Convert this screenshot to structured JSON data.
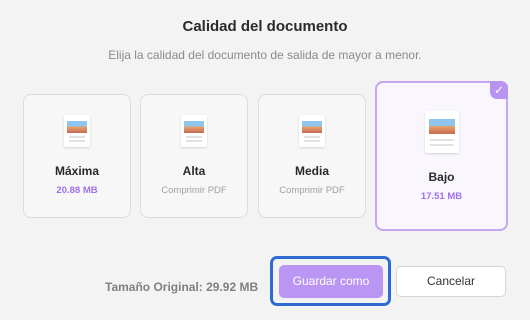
{
  "dialog": {
    "title": "Calidad del documento",
    "subtitle": "Elija la calidad del documento de salida de mayor a menor."
  },
  "options": [
    {
      "label": "Máxima",
      "detail": "20.88 MB",
      "selected": false
    },
    {
      "label": "Alta",
      "detail": "Comprimir PDF",
      "selected": false
    },
    {
      "label": "Media",
      "detail": "Comprimir PDF",
      "selected": false
    },
    {
      "label": "Bajo",
      "detail": "17.51 MB",
      "selected": true
    }
  ],
  "footer": {
    "original_size": "Tamaño Original: 29.92 MB",
    "save_label": "Guardar como",
    "cancel_label": "Cancelar"
  },
  "icons": {
    "check": "✓"
  },
  "colors": {
    "accent": "#bb95f3",
    "accent_text": "#a070ec",
    "focus": "#2e6bd3"
  }
}
